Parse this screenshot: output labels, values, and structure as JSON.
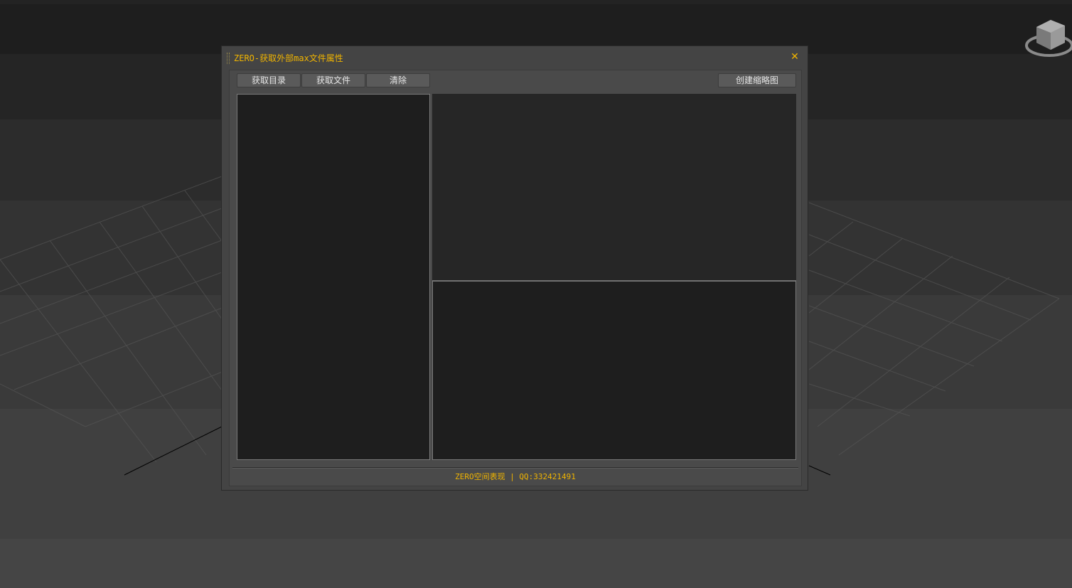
{
  "dialog": {
    "title": "ZERO-获取外部max文件属性",
    "close_symbol": "✕"
  },
  "toolbar": {
    "get_directory_label": "获取目录",
    "get_file_label": "获取文件",
    "clear_label": "清除",
    "create_thumbnail_label": "创建缩略图"
  },
  "footer": {
    "credit": "ZERO空间表现 | QQ:332421491"
  },
  "icons": {
    "viewcube": "viewcube-icon",
    "close": "close-icon"
  },
  "colors": {
    "accent": "#f0b400",
    "dialog_bg": "#444444",
    "panel_bg": "#1e1e1e"
  }
}
